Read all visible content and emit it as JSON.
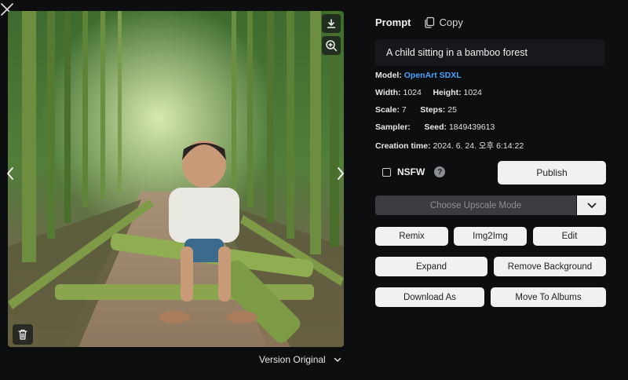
{
  "prompt": {
    "label": "Prompt",
    "copy_label": "Copy",
    "text": "A child sitting in a bamboo forest"
  },
  "meta": {
    "model_label": "Model:",
    "model_value": "OpenArt SDXL",
    "width_label": "Width:",
    "width_value": "1024",
    "height_label": "Height:",
    "height_value": "1024",
    "scale_label": "Scale:",
    "scale_value": "7",
    "steps_label": "Steps:",
    "steps_value": "25",
    "sampler_label": "Sampler:",
    "sampler_value": "",
    "seed_label": "Seed:",
    "seed_value": "1849439613",
    "creation_label": "Creation time:",
    "creation_value": "2024. 6. 24. 오후 6:14:22"
  },
  "nsfw": {
    "label": "NSFW",
    "checked": false,
    "help_glyph": "?"
  },
  "actions": {
    "publish": "Publish",
    "upscale_placeholder": "Choose Upscale Mode",
    "remix": "Remix",
    "img2img": "Img2Img",
    "edit": "Edit",
    "expand": "Expand",
    "remove_background": "Remove Background",
    "download_as": "Download As",
    "move_to_albums": "Move To Albums"
  },
  "version": {
    "label": "Version Original"
  },
  "icons": {
    "close": "close-icon",
    "download": "download-icon",
    "zoom": "zoom-in-icon",
    "trash": "trash-icon",
    "prev": "chevron-left-icon",
    "next": "chevron-right-icon",
    "copy": "copy-icon",
    "dropdown": "chevron-down-icon"
  },
  "colors": {
    "background": "#0d0e10",
    "link": "#4aa3ff",
    "button": "#f1f1f1",
    "disabled_select": "#3a3c41"
  }
}
